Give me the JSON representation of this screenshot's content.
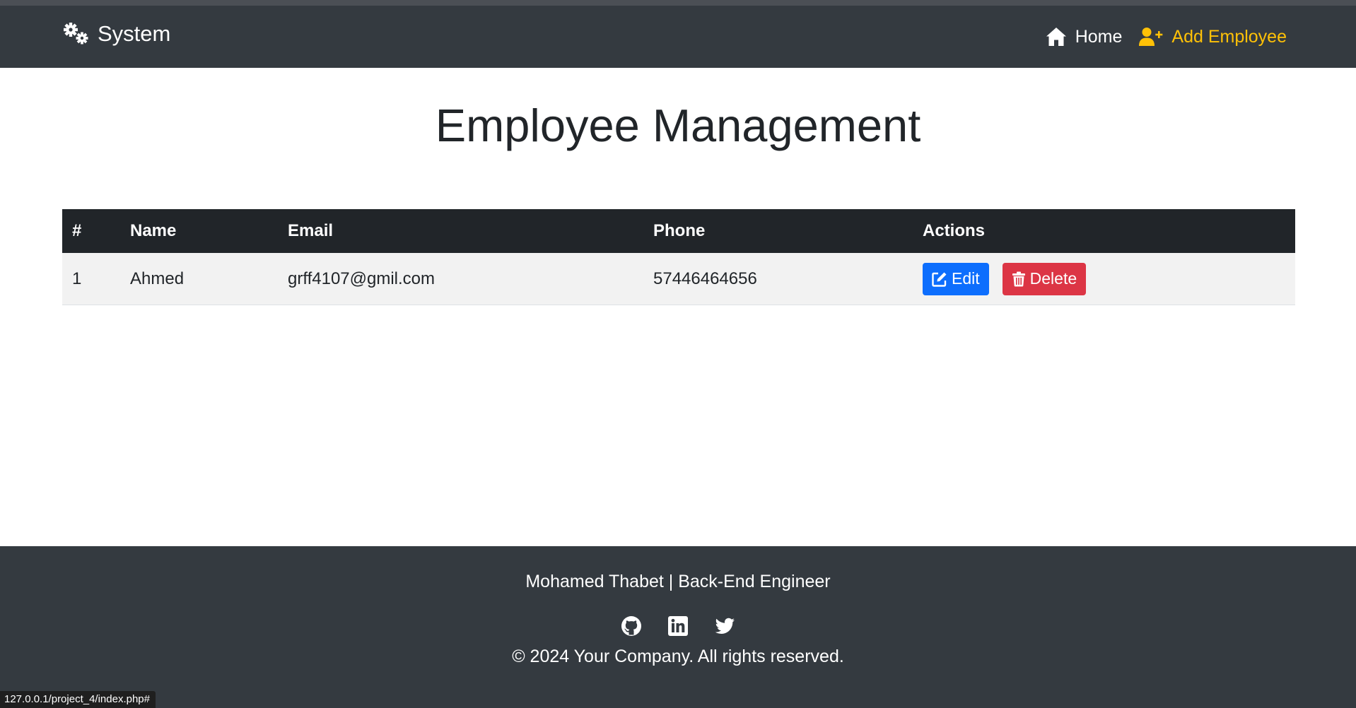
{
  "navbar": {
    "brand_label": "System",
    "brand_icon": "gears-icon",
    "links": [
      {
        "label": "Home",
        "icon": "home-icon",
        "active": false
      },
      {
        "label": "Add Employee",
        "icon": "user-plus-icon",
        "active": true
      }
    ],
    "colors": {
      "background": "#343a40",
      "active_link": "#ffc107"
    }
  },
  "main": {
    "title": "Employee Management",
    "table": {
      "headers": [
        "#",
        "Name",
        "Email",
        "Phone",
        "Actions"
      ],
      "rows": [
        {
          "id": "1",
          "name": "Ahmed",
          "email": "grff4107@gmil.com",
          "phone": "57446464656",
          "edit_label": "Edit",
          "delete_label": "Delete"
        }
      ]
    },
    "colors": {
      "header_bg": "#212529",
      "edit": "#0d6efd",
      "delete": "#dc3545"
    }
  },
  "footer": {
    "author": "Mohamed Thabet | Back-End Engineer",
    "social": [
      {
        "icon": "github-icon"
      },
      {
        "icon": "linkedin-icon"
      },
      {
        "icon": "twitter-icon"
      }
    ],
    "copyright": "© 2024 Your Company. All rights reserved."
  },
  "status_bar": {
    "url": "127.0.0.1/project_4/index.php#"
  }
}
